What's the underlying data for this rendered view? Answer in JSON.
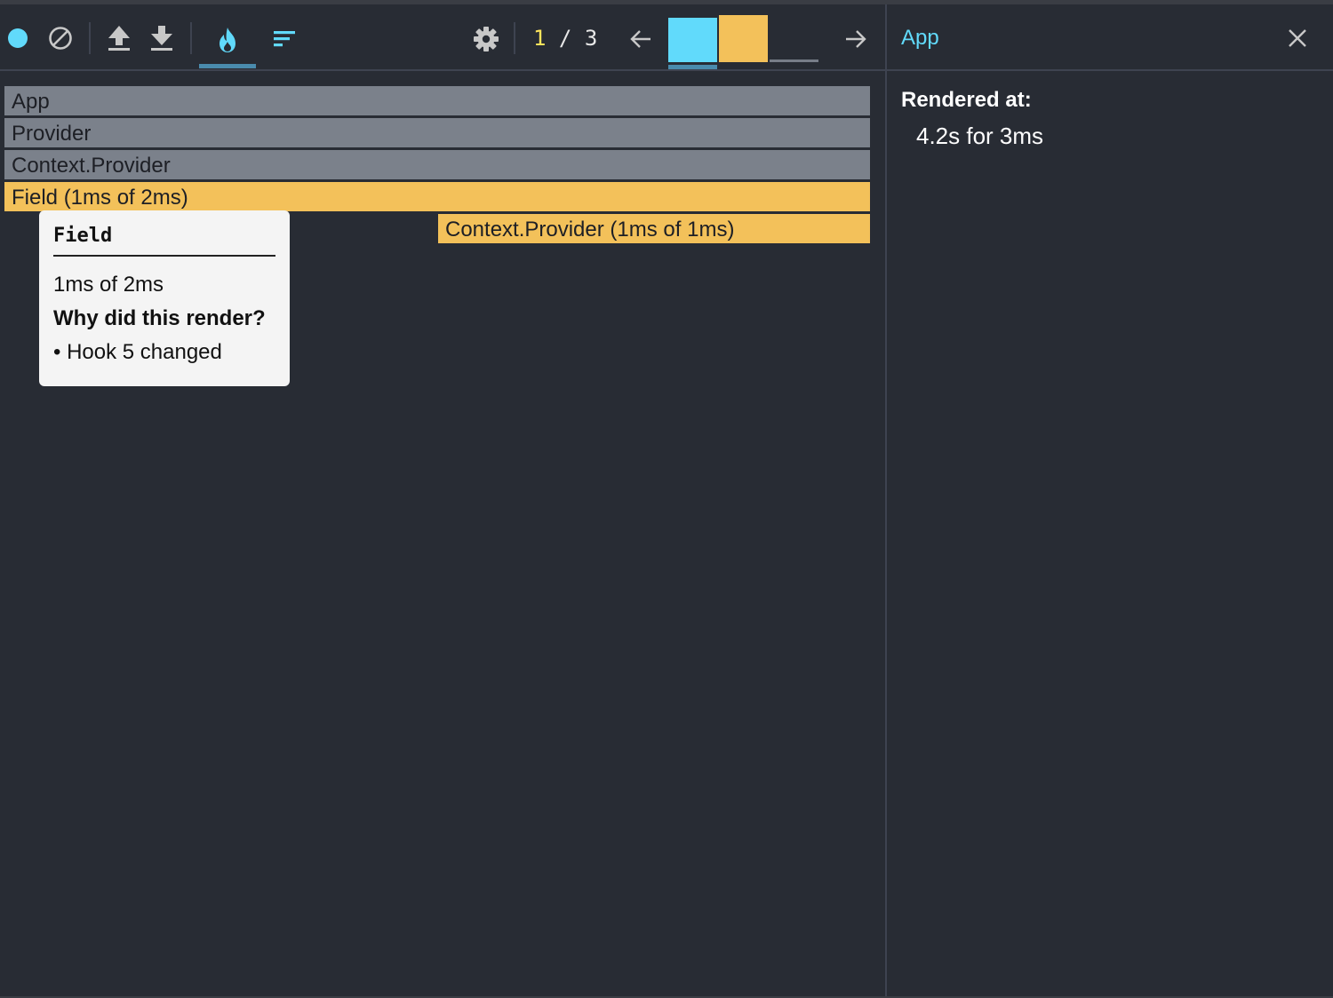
{
  "colors": {
    "background": "#282c34",
    "accent": "#61dafb",
    "bar_inactive": "#7b818b",
    "bar_rendered": "#f3c15a",
    "counter_current": "#ffe55c"
  },
  "toolbar": {
    "icons": [
      "record-icon",
      "clear-icon",
      "upload-icon",
      "download-icon",
      "flame-chart-icon",
      "ranked-chart-icon",
      "gear-icon",
      "arrow-left-icon",
      "arrow-right-icon"
    ],
    "commit_counter": {
      "current": "1",
      "sep": " / ",
      "total": "3"
    },
    "commits": [
      {
        "color": "#61dafb",
        "level": 0.95,
        "selected": true
      },
      {
        "color": "#f3c15a",
        "level": 1.0,
        "selected": false
      },
      {
        "color": "#777d88",
        "level": 0.05,
        "selected": false
      }
    ]
  },
  "flamegraph": {
    "rows": [
      {
        "label": "App",
        "state": "inactive"
      },
      {
        "label": "Provider",
        "state": "inactive"
      },
      {
        "label": "Context.Provider",
        "state": "inactive"
      },
      {
        "label": "Field (1ms of 2ms)",
        "state": "rendered"
      },
      {
        "label": "Context.Provider (1ms of 1ms)",
        "state": "rendered"
      }
    ]
  },
  "tooltip": {
    "title": "Field",
    "duration": "1ms of 2ms",
    "why_heading": "Why did this render?",
    "reasons": [
      "• Hook 5 changed"
    ]
  },
  "sidebar": {
    "title": "App",
    "rendered_at_label": "Rendered at:",
    "rendered_at_value": "4.2s for 3ms"
  }
}
